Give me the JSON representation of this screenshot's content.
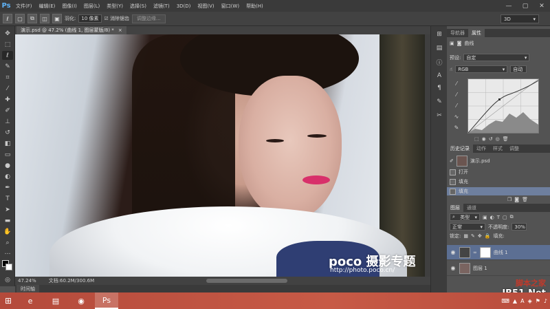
{
  "app": {
    "logo": "Ps"
  },
  "menu": [
    "文件(F)",
    "编辑(E)",
    "图像(I)",
    "图层(L)",
    "类型(Y)",
    "选择(S)",
    "滤镜(T)",
    "3D(D)",
    "视图(V)",
    "窗口(W)",
    "帮助(H)"
  ],
  "window_controls": {
    "minimize": "—",
    "maximize": "▢",
    "close": "✕"
  },
  "options": {
    "feather_label": "羽化:",
    "feather_value": "10 像素",
    "antialias_label": "消除锯齿",
    "refine_edge": "调整边缘...",
    "workspace": "3D"
  },
  "document": {
    "tab_title": "演示.psd @ 47.2% (曲线 1, 图层蒙版/8) *",
    "close": "×",
    "zoom": "47.24%",
    "doc_size": "文档:60.2M/300.6M",
    "timeline": "时间轴"
  },
  "watermark": {
    "brand": "poco 摄影专题",
    "url": "http://photo.poco.cn/"
  },
  "properties": {
    "tabs": [
      "导航器",
      "属性"
    ],
    "title": "曲线",
    "preset_label": "预设:",
    "preset_value": "自定",
    "channel": "RGB",
    "auto_button": "自动"
  },
  "history": {
    "tabs": [
      "历史记录",
      "动作",
      "样式",
      "调整"
    ],
    "snapshot": "演示.psd",
    "items": [
      "打开",
      "填充",
      "填充"
    ]
  },
  "layers": {
    "tabs": [
      "图层",
      "通道"
    ],
    "filter_kind": "类型",
    "blend_mode": "正常",
    "opacity_label": "不透明度:",
    "opacity_value": "30%",
    "lock_label": "锁定:",
    "fill_label": "填充:",
    "rows": [
      {
        "name": "曲线 1"
      },
      {
        "name": "图层 1"
      }
    ]
  },
  "taskbar": {
    "start": "⊞",
    "apps": [
      "e",
      "▤",
      "◉",
      "Ps"
    ],
    "tray": [
      "⌨",
      "▲",
      "A",
      "◈",
      "⚑",
      "♪"
    ]
  },
  "site_watermark": {
    "top": "脚本之家",
    "bottom": "JB51.Net"
  }
}
